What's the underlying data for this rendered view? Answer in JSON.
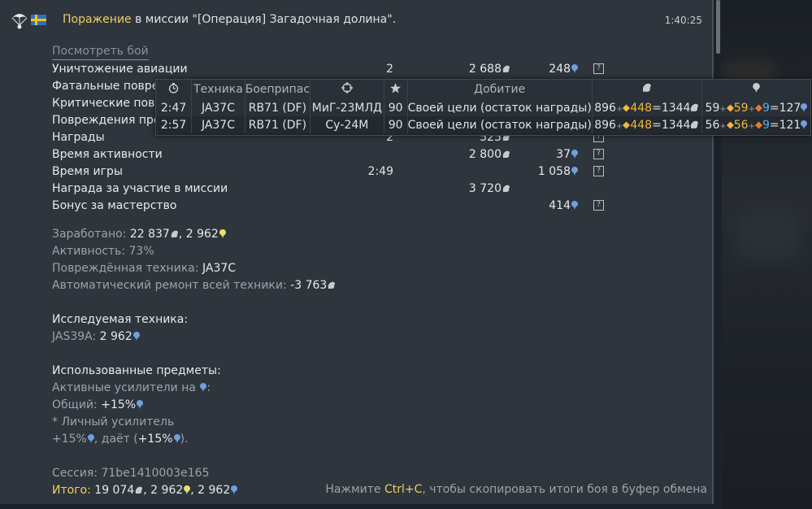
{
  "header": {
    "result": "Поражение",
    "mission_text": " в миссии \"[Операция] Загадочная долина\".",
    "time": "1:40:25"
  },
  "view_battle": "Посмотреть бой",
  "rows": [
    {
      "label": "Уничтожение авиации",
      "count": "2",
      "silver": "2 688",
      "rp": "248"
    },
    {
      "label": "Фатальные поврежд",
      "count": "",
      "silver": "",
      "rp": ""
    },
    {
      "label": "Критические повреж",
      "count": "",
      "silver": "",
      "rp": ""
    },
    {
      "label": "Повреждения проти",
      "count": "",
      "silver": "",
      "rp": ""
    },
    {
      "label": "Награды",
      "count": "2",
      "silver": "525",
      "rp": ""
    },
    {
      "label": "Время активности",
      "count": "",
      "silver": "2 800",
      "rp": "37"
    },
    {
      "label": "Время игры",
      "count": "2:49",
      "silver": "",
      "rp": "1 058"
    },
    {
      "label": "Награда за участие в миссии",
      "count": "",
      "silver": "3 720",
      "rp": ""
    },
    {
      "label": "Бонус за мастерство",
      "count": "",
      "silver": "",
      "rp": "414"
    }
  ],
  "help_glyph": "?",
  "summary": {
    "earned_label": "Заработано: ",
    "earned_silver": "22 837",
    "earned_sep": ", ",
    "earned_rp": "2 962",
    "activity": "Активность: 73%",
    "damaged_label": "Повреждённая техника: ",
    "damaged_value": "JA37C",
    "repair_label": "Автоматический ремонт всей техники: ",
    "repair_value": "-3 763",
    "research_title": "Исследуемая техника:",
    "research_vehicle": "JAS39A: ",
    "research_rp": "2 962",
    "items_title": "Использованные предметы:",
    "boosters_label": "Активные усилители на ",
    "boosters_colon": ":",
    "general_label": "Общий: ",
    "general_value": "+15%",
    "personal": "* Личный усилитель",
    "personal_value": "+15%",
    "gives": ", даёт (",
    "gives_value": "+15%",
    "gives_end": ").",
    "session": "Сессия: 71be1410003e165",
    "total_label": "Итого:",
    "total_silver": " 19 074",
    "total_mid": ", 2 962",
    "total_end": ", 2 962"
  },
  "hint": {
    "pre": "Нажмите ",
    "key": "Ctrl+C",
    "post": ", чтобы скопировать итоги боя в буфер обмена"
  },
  "tooltip": {
    "headers": [
      "Техника",
      "Боеприпас",
      "Добитие"
    ],
    "rows": [
      {
        "time": "2:47",
        "vehicle": "JA37C",
        "ammo": "RB71 (DF)",
        "target": "МиГ-23МЛД",
        "score": "90",
        "finish": "Своей цели (остаток награды)",
        "s_base": "896",
        "s_plus": "+",
        "s_bonus": "448",
        "s_eq": "=1344",
        "r_base": "59",
        "r_plus1": "+",
        "r_b1": "59",
        "r_plus2": "+",
        "r_b2": "9",
        "r_eq": "=127"
      },
      {
        "time": "2:57",
        "vehicle": "JA37C",
        "ammo": "RB71 (DF)",
        "target": "Су-24М",
        "score": "90",
        "finish": "Своей цели (остаток награды)",
        "s_base": "896",
        "s_plus": "+",
        "s_bonus": "448",
        "s_eq": "=1344",
        "r_base": "56",
        "r_plus1": "+",
        "r_b1": "56",
        "r_plus2": "+",
        "r_b2": "9",
        "r_eq": "=121"
      }
    ]
  },
  "colors": {
    "accent": "#f0d060",
    "rp": "#6f9fe0",
    "panel": "#2e353d"
  },
  "icons": [
    "parachute-icon",
    "sweden-flag-icon",
    "silver-lion-icon",
    "research-point-icon",
    "clock-icon",
    "crosshair-icon",
    "star-icon",
    "help-icon"
  ]
}
